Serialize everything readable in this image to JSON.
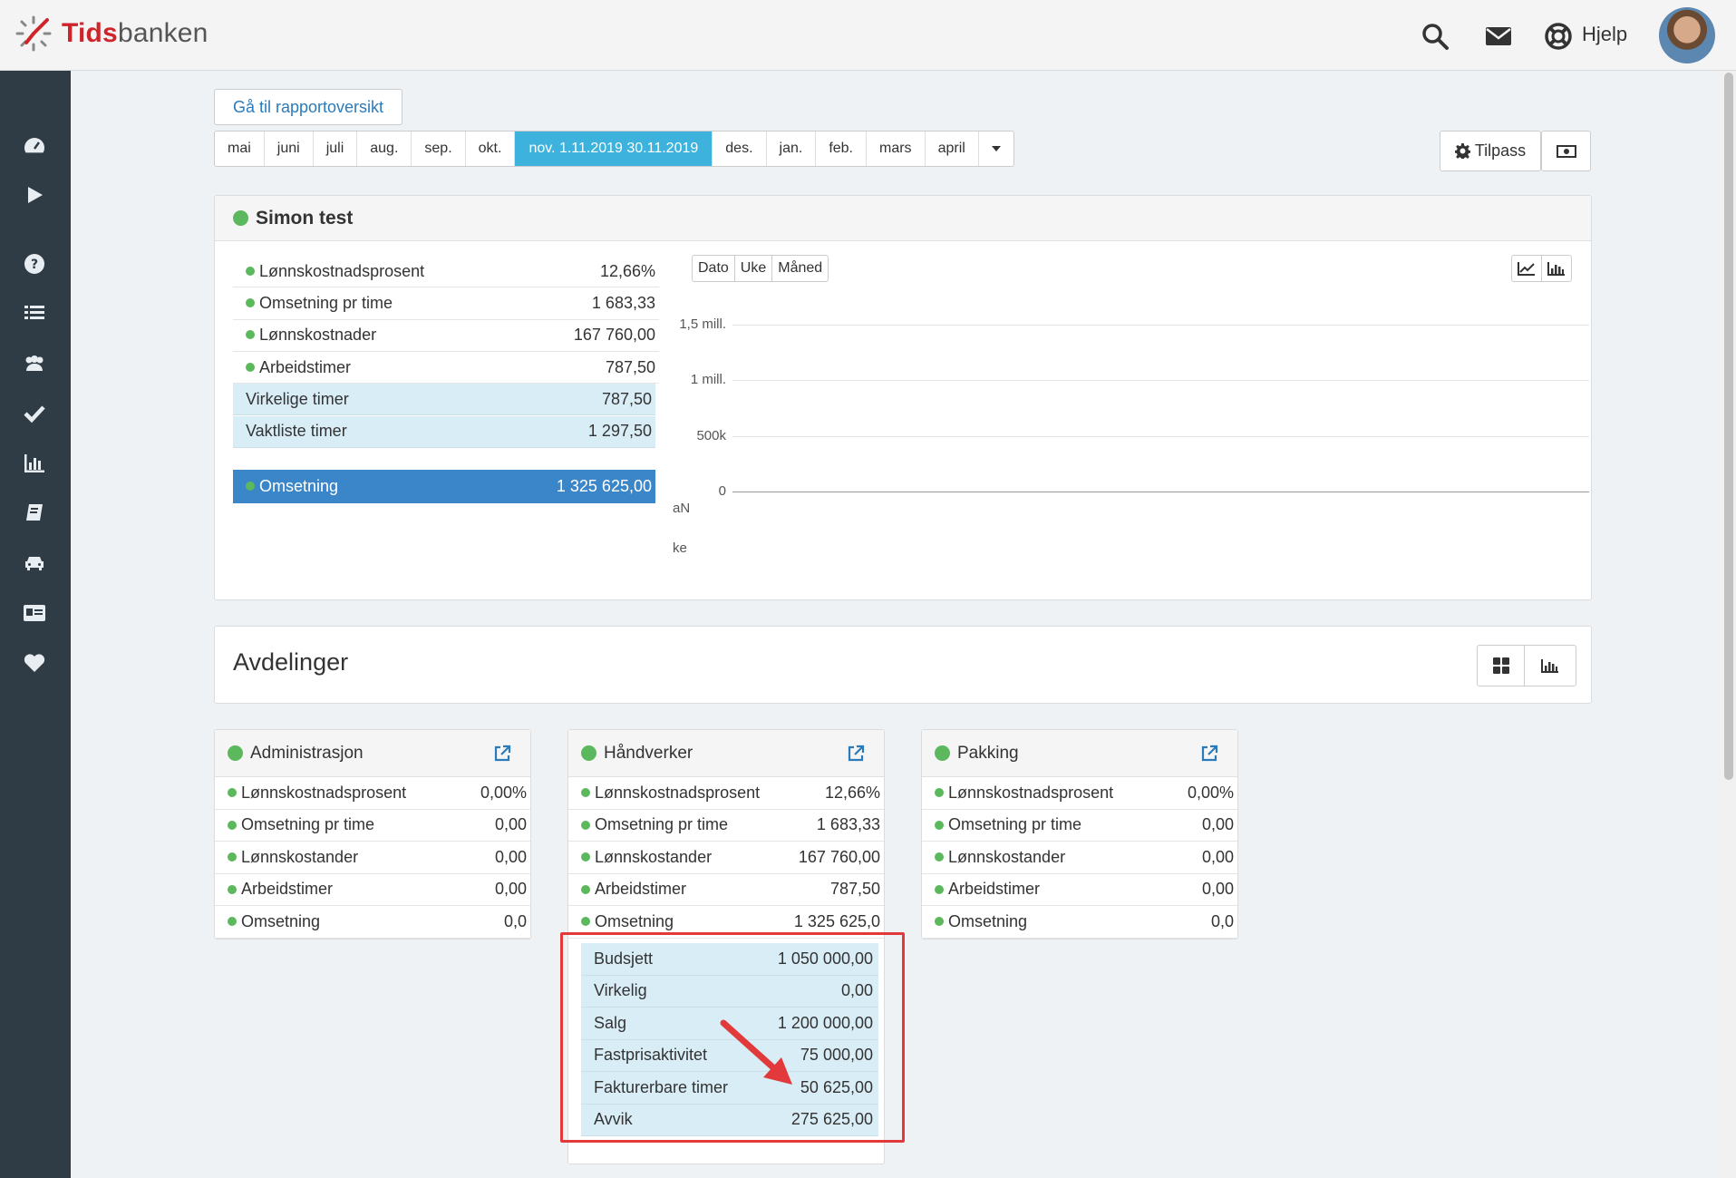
{
  "app": {
    "logo_prefix": "Tids",
    "logo_suffix": "banken",
    "help_label": "Hjelp"
  },
  "topbar_icons": [
    "search-icon",
    "mail-icon",
    "lifebuoy-icon"
  ],
  "sidebar_icons": [
    "dashboard-icon",
    "play-icon",
    "question-icon",
    "list-icon",
    "users-icon",
    "check-icon",
    "bar-chart-icon",
    "book-icon",
    "car-icon",
    "id-card-icon",
    "heart-icon"
  ],
  "report_link_label": "Gå til rapportoversikt",
  "months": [
    {
      "label": "mai",
      "active": false
    },
    {
      "label": "juni",
      "active": false
    },
    {
      "label": "juli",
      "active": false
    },
    {
      "label": "aug.",
      "active": false
    },
    {
      "label": "sep.",
      "active": false
    },
    {
      "label": "okt.",
      "active": false
    },
    {
      "label": "nov. 1.11.2019 30.11.2019",
      "active": true
    },
    {
      "label": "des.",
      "active": false
    },
    {
      "label": "jan.",
      "active": false
    },
    {
      "label": "feb.",
      "active": false
    },
    {
      "label": "mars",
      "active": false
    },
    {
      "label": "april",
      "active": false
    }
  ],
  "tilpass_label": "Tilpass",
  "summary": {
    "title": "Simon test",
    "rows": [
      {
        "label": "Lønnskostnadsprosent",
        "value": "12,66%",
        "dot": true
      },
      {
        "label": "Omsetning pr time",
        "value": "1 683,33",
        "dot": true
      },
      {
        "label": "Lønnskostnader",
        "value": "167 760,00",
        "dot": true
      },
      {
        "label": "Arbeidstimer",
        "value": "787,50",
        "dot": true
      }
    ],
    "highlight_rows": [
      {
        "label": "Virkelige timer",
        "value": "787,50"
      },
      {
        "label": "Vaktliste timer",
        "value": "1 297,50"
      }
    ],
    "total": {
      "label": "Omsetning",
      "value": "1 325 625,00"
    }
  },
  "chart_tabs": [
    "Dato",
    "Uke",
    "Måned"
  ],
  "chart_data": {
    "type": "line",
    "y_ticks": [
      "1,5 mill.",
      "1 mill.",
      "500k",
      "0"
    ],
    "ylim": [
      0,
      1500000
    ],
    "x_tick_labels": [
      "aN",
      "ke"
    ],
    "series": []
  },
  "departments_title": "Avdelinger",
  "departments": [
    {
      "name": "Administrasjon",
      "rows": [
        {
          "label": "Lønnskostnadsprosent",
          "value": "0,00%"
        },
        {
          "label": "Omsetning pr time",
          "value": "0,00"
        },
        {
          "label": "Lønnskostander",
          "value": "0,00"
        },
        {
          "label": "Arbeidstimer",
          "value": "0,00"
        },
        {
          "label": "Omsetning",
          "value": "0,0"
        }
      ]
    },
    {
      "name": "Håndverker",
      "rows": [
        {
          "label": "Lønnskostnadsprosent",
          "value": "12,66%"
        },
        {
          "label": "Omsetning pr time",
          "value": "1 683,33"
        },
        {
          "label": "Lønnskostander",
          "value": "167 760,00"
        },
        {
          "label": "Arbeidstimer",
          "value": "787,50"
        },
        {
          "label": "Omsetning",
          "value": "1 325 625,0"
        }
      ],
      "details": [
        {
          "label": "Budsjett",
          "value": "1 050 000,00"
        },
        {
          "label": "Virkelig",
          "value": "0,00"
        },
        {
          "label": "Salg",
          "value": "1 200 000,00"
        },
        {
          "label": "Fastprisaktivitet",
          "value": "75 000,00"
        },
        {
          "label": "Fakturerbare timer",
          "value": "50 625,00"
        },
        {
          "label": "Avvik",
          "value": "275 625,00"
        }
      ]
    },
    {
      "name": "Pakking",
      "rows": [
        {
          "label": "Lønnskostnadsprosent",
          "value": "0,00%"
        },
        {
          "label": "Omsetning pr time",
          "value": "0,00"
        },
        {
          "label": "Lønnskostander",
          "value": "0,00"
        },
        {
          "label": "Arbeidstimer",
          "value": "0,00"
        },
        {
          "label": "Omsetning",
          "value": "0,0"
        }
      ]
    }
  ],
  "colors": {
    "sidebar": "#2f3b45",
    "active_month": "#3db2dc",
    "total_row": "#3a86c9",
    "status_dot": "#5cb85c",
    "annotation": "#e23a3a"
  }
}
